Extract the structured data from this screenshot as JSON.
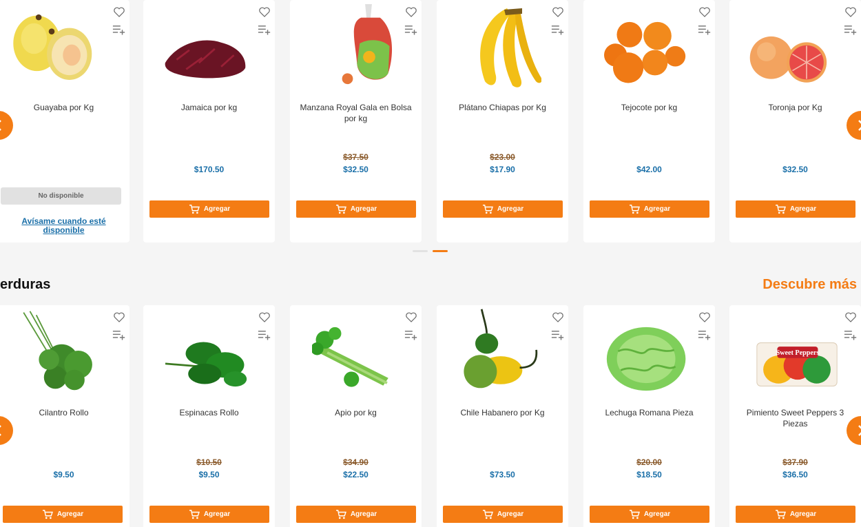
{
  "row1": {
    "products": [
      {
        "name": "Guayaba por Kg",
        "old_price": "",
        "price": "",
        "button": "",
        "unavailable": "No disponible",
        "notify": "Avísame cuando esté disponible",
        "image": "guava-image"
      },
      {
        "name": "Jamaica por kg",
        "old_price": "",
        "price": "$170.50",
        "button": "Agregar",
        "image": "hibiscus-image"
      },
      {
        "name": "Manzana Royal Gala en Bolsa por kg",
        "old_price": "$37.50",
        "price": "$32.50",
        "button": "Agregar",
        "image": "apple-bag-image"
      },
      {
        "name": "Plátano Chiapas por Kg",
        "old_price": "$23.00",
        "price": "$17.90",
        "button": "Agregar",
        "image": "banana-image"
      },
      {
        "name": "Tejocote por kg",
        "old_price": "",
        "price": "$42.00",
        "button": "Agregar",
        "image": "tejocote-image"
      },
      {
        "name": "Toronja por Kg",
        "old_price": "",
        "price": "$32.50",
        "button": "Agregar",
        "image": "grapefruit-image"
      }
    ]
  },
  "section": {
    "title": "erduras",
    "more_link": "Descubre más"
  },
  "row2": {
    "products": [
      {
        "name": "Cilantro Rollo",
        "old_price": "",
        "price": "$9.50",
        "button": "Agregar",
        "image": "cilantro-image"
      },
      {
        "name": "Espinacas Rollo",
        "old_price": "$10.50",
        "price": "$9.50",
        "button": "Agregar",
        "image": "spinach-image"
      },
      {
        "name": "Apio por kg",
        "old_price": "$34.90",
        "price": "$22.50",
        "button": "Agregar",
        "image": "celery-image"
      },
      {
        "name": "Chile Habanero por Kg",
        "old_price": "",
        "price": "$73.50",
        "button": "Agregar",
        "image": "habanero-image"
      },
      {
        "name": "Lechuga Romana Pieza",
        "old_price": "$20.00",
        "price": "$18.50",
        "button": "Agregar",
        "image": "lettuce-image"
      },
      {
        "name": "Pimiento Sweet Peppers 3 Piezas",
        "old_price": "$37.90",
        "price": "$36.50",
        "button": "Agregar",
        "image": "peppers-image"
      }
    ]
  },
  "carousel": {
    "active_page": 2,
    "page_count": 2
  },
  "package_label": "Sweet Peppers",
  "colors": {
    "accent": "#f47c14",
    "price": "#1a6fa8",
    "old_price": "#8a5a2b",
    "background": "#f5f5f5"
  },
  "icons": {
    "favorite": "heart-icon",
    "add_to_list": "add-to-list-icon",
    "cart": "cart-icon",
    "prev": "chevron-left-icon",
    "next": "chevron-right-icon"
  }
}
